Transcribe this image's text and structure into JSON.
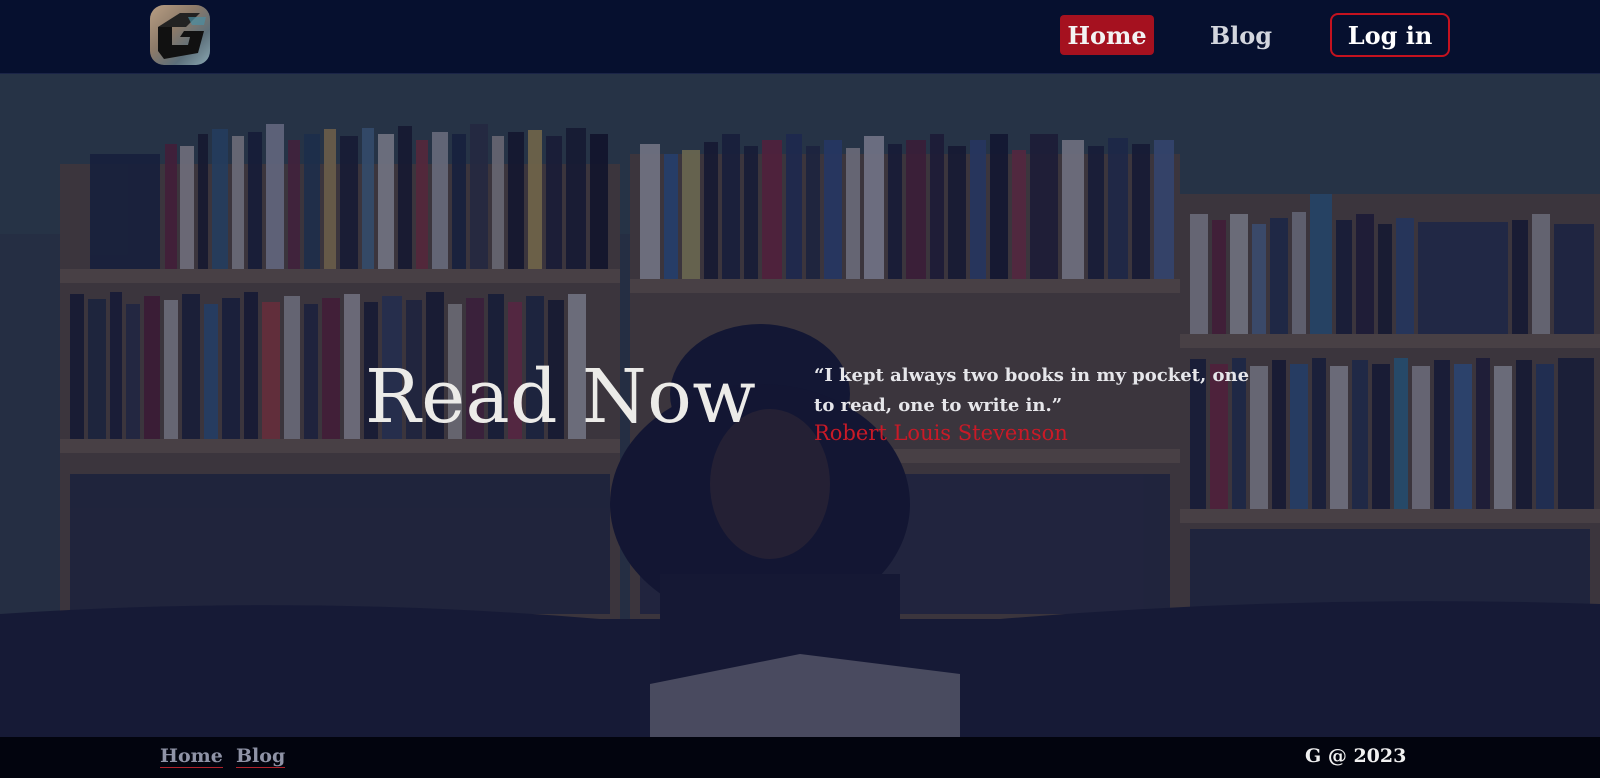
{
  "header": {
    "logo_alt": "G",
    "nav": {
      "home": "Home",
      "blog": "Blog",
      "login": "Log in"
    }
  },
  "hero": {
    "title": "Read Now",
    "quote": "“I kept always two books in my pocket, one to read, one to write in.”",
    "author": "Robert Louis Stevenson"
  },
  "footer": {
    "links": {
      "home": "Home",
      "blog": "Blog"
    },
    "copyright": "G @ 2023"
  },
  "colors": {
    "header_bg": "#06102f",
    "accent_red": "#a5111f",
    "footer_bg": "#02040e"
  }
}
